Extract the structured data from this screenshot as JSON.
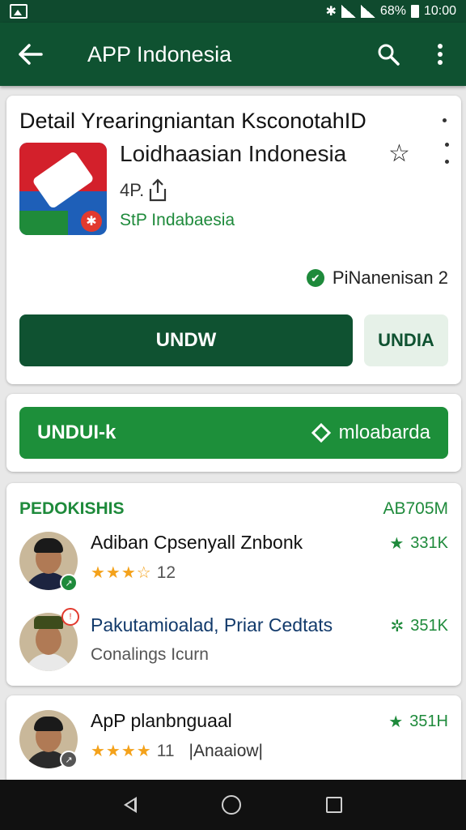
{
  "status_bar": {
    "battery": "68%",
    "time": "10:00"
  },
  "app_bar": {
    "title": "APP Indonesia"
  },
  "app_card": {
    "headline": "Detail Yrearingniantan KsconotahID",
    "app_name": "Loidhaasian Indonesia",
    "size": "4P.",
    "publisher": "StP Indabaesia",
    "verified_label": "PiNanenisan 2",
    "primary_button": "UNDW",
    "secondary_button": "UNDIA"
  },
  "action_card": {
    "button_label": "UNDUI-k",
    "button_right": "mloabarda"
  },
  "list_section": {
    "title": "PEDOKISHIS",
    "count": "AB705M",
    "items": [
      {
        "name": "Adiban Cpsenyall Znbonk",
        "stars": "★★★☆",
        "rating": "12",
        "stat": "331K"
      },
      {
        "name": "Pakutamioalad, Priar Cedtats",
        "sub": "Conalings Icurn",
        "stat": "351K"
      }
    ]
  },
  "bottom_item": {
    "name": "ApP planbnguaal",
    "stars": "★★★★",
    "rating": "11",
    "tag": "|Anaaiow|",
    "stat": "351H"
  },
  "colors": {
    "primary_dark": "#0f5231",
    "accent_green": "#1d8f3a",
    "star": "#f4a21b"
  }
}
